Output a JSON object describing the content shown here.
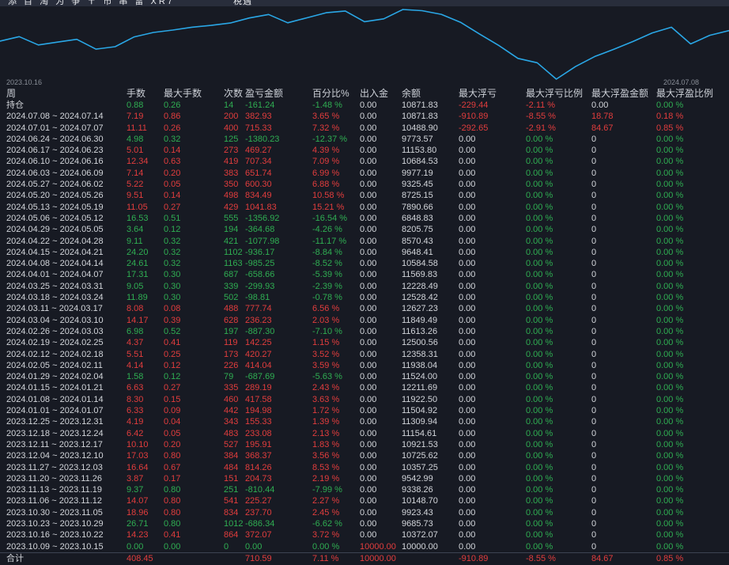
{
  "toolbar": {
    "left_text": "添 目 淘 为 争 〒 市 串 雷 XR7",
    "center_text": "税遇"
  },
  "chart": {
    "start_label": "2023.10.16",
    "end_label": "2024.07.08",
    "line_color": "#2aa7e6"
  },
  "chart_data": {
    "type": "line",
    "title": "",
    "xlabel": "",
    "ylabel": "",
    "legend": false,
    "grid": false,
    "x": [
      "2023.10.09",
      "2023.10.16",
      "2023.10.23",
      "2023.10.30",
      "2023.11.06",
      "2023.11.13",
      "2023.11.20",
      "2023.11.27",
      "2023.12.04",
      "2023.12.11",
      "2023.12.18",
      "2023.12.25",
      "2024.01.01",
      "2024.01.08",
      "2024.01.15",
      "2024.01.29",
      "2024.02.05",
      "2024.02.12",
      "2024.02.19",
      "2024.02.26",
      "2024.03.04",
      "2024.03.11",
      "2024.03.18",
      "2024.03.25",
      "2024.04.01",
      "2024.04.08",
      "2024.04.15",
      "2024.04.22",
      "2024.04.29",
      "2024.05.06",
      "2024.05.13",
      "2024.05.20",
      "2024.05.27",
      "2024.06.03",
      "2024.06.10",
      "2024.06.17",
      "2024.06.24",
      "2024.07.01",
      "2024.07.08"
    ],
    "values": [
      10000.0,
      10372.07,
      9685.73,
      9923.43,
      10148.7,
      9338.26,
      9542.99,
      10357.25,
      10725.62,
      10921.53,
      11154.61,
      11309.94,
      11504.92,
      11922.5,
      12211.69,
      11524.0,
      11938.04,
      12358.31,
      12500.56,
      11613.26,
      11849.49,
      12627.23,
      12528.42,
      12228.49,
      11569.83,
      10584.58,
      9648.41,
      8570.43,
      8205.75,
      6848.83,
      7890.66,
      8725.15,
      9325.45,
      9977.19,
      10684.53,
      11153.8,
      9773.57,
      10488.9,
      10871.83
    ],
    "ylim": [
      6848.83,
      12627.23
    ],
    "x_axis_start_label": "2023.10.16",
    "x_axis_end_label": "2024.07.08"
  },
  "colors": {
    "positive_red": "#e23d3d",
    "negative_green": "#2fae52",
    "chart_line": "#2aa7e6",
    "background": "#171a23"
  },
  "table": {
    "headers": [
      "周",
      "手数",
      "最大手数",
      "次数",
      "盈亏金额",
      "百分比%",
      "出入金",
      "余额",
      "最大浮亏",
      "最大浮亏比例",
      "最大浮盈金额",
      "最大浮盈比例"
    ],
    "rows": [
      [
        "持仓",
        "0.88",
        "0.26",
        "14",
        "-161.24",
        "-1.48 %",
        "0.00",
        "10871.83",
        "-229.44",
        "-2.11 %",
        "0.00",
        "0.00 %"
      ],
      [
        "2024.07.08 ~ 2024.07.14",
        "7.19",
        "0.86",
        "200",
        "382.93",
        "3.65 %",
        "0.00",
        "10871.83",
        "-910.89",
        "-8.55 %",
        "18.78",
        "0.18 %"
      ],
      [
        "2024.07.01 ~ 2024.07.07",
        "11.11",
        "0.26",
        "400",
        "715.33",
        "7.32 %",
        "0.00",
        "10488.90",
        "-292.65",
        "-2.91 %",
        "84.67",
        "0.85 %"
      ],
      [
        "2024.06.24 ~ 2024.06.30",
        "4.98",
        "0.32",
        "125",
        "-1380.23",
        "-12.37 %",
        "0.00",
        "9773.57",
        "0.00",
        "0.00 %",
        "0",
        "0.00 %"
      ],
      [
        "2024.06.17 ~ 2024.06.23",
        "5.01",
        "0.14",
        "273",
        "469.27",
        "4.39 %",
        "0.00",
        "11153.80",
        "0.00",
        "0.00 %",
        "0",
        "0.00 %"
      ],
      [
        "2024.06.10 ~ 2024.06.16",
        "12.34",
        "0.63",
        "419",
        "707.34",
        "7.09 %",
        "0.00",
        "10684.53",
        "0.00",
        "0.00 %",
        "0",
        "0.00 %"
      ],
      [
        "2024.06.03 ~ 2024.06.09",
        "7.14",
        "0.20",
        "383",
        "651.74",
        "6.99 %",
        "0.00",
        "9977.19",
        "0.00",
        "0.00 %",
        "0",
        "0.00 %"
      ],
      [
        "2024.05.27 ~ 2024.06.02",
        "5.22",
        "0.05",
        "350",
        "600.30",
        "6.88 %",
        "0.00",
        "9325.45",
        "0.00",
        "0.00 %",
        "0",
        "0.00 %"
      ],
      [
        "2024.05.20 ~ 2024.05.26",
        "9.51",
        "0.14",
        "498",
        "834.49",
        "10.58 %",
        "0.00",
        "8725.15",
        "0.00",
        "0.00 %",
        "0",
        "0.00 %"
      ],
      [
        "2024.05.13 ~ 2024.05.19",
        "11.05",
        "0.27",
        "429",
        "1041.83",
        "15.21 %",
        "0.00",
        "7890.66",
        "0.00",
        "0.00 %",
        "0",
        "0.00 %"
      ],
      [
        "2024.05.06 ~ 2024.05.12",
        "16.53",
        "0.51",
        "555",
        "-1356.92",
        "-16.54 %",
        "0.00",
        "6848.83",
        "0.00",
        "0.00 %",
        "0",
        "0.00 %"
      ],
      [
        "2024.04.29 ~ 2024.05.05",
        "3.64",
        "0.12",
        "194",
        "-364.68",
        "-4.26 %",
        "0.00",
        "8205.75",
        "0.00",
        "0.00 %",
        "0",
        "0.00 %"
      ],
      [
        "2024.04.22 ~ 2024.04.28",
        "9.11",
        "0.32",
        "421",
        "-1077.98",
        "-11.17 %",
        "0.00",
        "8570.43",
        "0.00",
        "0.00 %",
        "0",
        "0.00 %"
      ],
      [
        "2024.04.15 ~ 2024.04.21",
        "24.20",
        "0.32",
        "1102",
        "-936.17",
        "-8.84 %",
        "0.00",
        "9648.41",
        "0.00",
        "0.00 %",
        "0",
        "0.00 %"
      ],
      [
        "2024.04.08 ~ 2024.04.14",
        "24.61",
        "0.32",
        "1163",
        "-985.25",
        "-8.52 %",
        "0.00",
        "10584.58",
        "0.00",
        "0.00 %",
        "0",
        "0.00 %"
      ],
      [
        "2024.04.01 ~ 2024.04.07",
        "17.31",
        "0.30",
        "687",
        "-658.66",
        "-5.39 %",
        "0.00",
        "11569.83",
        "0.00",
        "0.00 %",
        "0",
        "0.00 %"
      ],
      [
        "2024.03.25 ~ 2024.03.31",
        "9.05",
        "0.30",
        "339",
        "-299.93",
        "-2.39 %",
        "0.00",
        "12228.49",
        "0.00",
        "0.00 %",
        "0",
        "0.00 %"
      ],
      [
        "2024.03.18 ~ 2024.03.24",
        "11.89",
        "0.30",
        "502",
        "-98.81",
        "-0.78 %",
        "0.00",
        "12528.42",
        "0.00",
        "0.00 %",
        "0",
        "0.00 %"
      ],
      [
        "2024.03.11 ~ 2024.03.17",
        "8.08",
        "0.08",
        "488",
        "777.74",
        "6.56 %",
        "0.00",
        "12627.23",
        "0.00",
        "0.00 %",
        "0",
        "0.00 %"
      ],
      [
        "2024.03.04 ~ 2024.03.10",
        "14.17",
        "0.39",
        "628",
        "236.23",
        "2.03 %",
        "0.00",
        "11849.49",
        "0.00",
        "0.00 %",
        "0",
        "0.00 %"
      ],
      [
        "2024.02.26 ~ 2024.03.03",
        "6.98",
        "0.52",
        "197",
        "-887.30",
        "-7.10 %",
        "0.00",
        "11613.26",
        "0.00",
        "0.00 %",
        "0",
        "0.00 %"
      ],
      [
        "2024.02.19 ~ 2024.02.25",
        "4.37",
        "0.41",
        "119",
        "142.25",
        "1.15 %",
        "0.00",
        "12500.56",
        "0.00",
        "0.00 %",
        "0",
        "0.00 %"
      ],
      [
        "2024.02.12 ~ 2024.02.18",
        "5.51",
        "0.25",
        "173",
        "420.27",
        "3.52 %",
        "0.00",
        "12358.31",
        "0.00",
        "0.00 %",
        "0",
        "0.00 %"
      ],
      [
        "2024.02.05 ~ 2024.02.11",
        "4.14",
        "0.12",
        "226",
        "414.04",
        "3.59 %",
        "0.00",
        "11938.04",
        "0.00",
        "0.00 %",
        "0",
        "0.00 %"
      ],
      [
        "2024.01.29 ~ 2024.02.04",
        "1.58",
        "0.12",
        "79",
        "-687.69",
        "-5.63 %",
        "0.00",
        "11524.00",
        "0.00",
        "0.00 %",
        "0",
        "0.00 %"
      ],
      [
        "2024.01.15 ~ 2024.01.21",
        "6.63",
        "0.27",
        "335",
        "289.19",
        "2.43 %",
        "0.00",
        "12211.69",
        "0.00",
        "0.00 %",
        "0",
        "0.00 %"
      ],
      [
        "2024.01.08 ~ 2024.01.14",
        "8.30",
        "0.15",
        "460",
        "417.58",
        "3.63 %",
        "0.00",
        "11922.50",
        "0.00",
        "0.00 %",
        "0",
        "0.00 %"
      ],
      [
        "2024.01.01 ~ 2024.01.07",
        "6.33",
        "0.09",
        "442",
        "194.98",
        "1.72 %",
        "0.00",
        "11504.92",
        "0.00",
        "0.00 %",
        "0",
        "0.00 %"
      ],
      [
        "2023.12.25 ~ 2023.12.31",
        "4.19",
        "0.04",
        "343",
        "155.33",
        "1.39 %",
        "0.00",
        "11309.94",
        "0.00",
        "0.00 %",
        "0",
        "0.00 %"
      ],
      [
        "2023.12.18 ~ 2023.12.24",
        "6.42",
        "0.05",
        "483",
        "233.08",
        "2.13 %",
        "0.00",
        "11154.61",
        "0.00",
        "0.00 %",
        "0",
        "0.00 %"
      ],
      [
        "2023.12.11 ~ 2023.12.17",
        "10.10",
        "0.20",
        "527",
        "195.91",
        "1.83 %",
        "0.00",
        "10921.53",
        "0.00",
        "0.00 %",
        "0",
        "0.00 %"
      ],
      [
        "2023.12.04 ~ 2023.12.10",
        "17.03",
        "0.80",
        "384",
        "368.37",
        "3.56 %",
        "0.00",
        "10725.62",
        "0.00",
        "0.00 %",
        "0",
        "0.00 %"
      ],
      [
        "2023.11.27 ~ 2023.12.03",
        "16.64",
        "0.67",
        "484",
        "814.26",
        "8.53 %",
        "0.00",
        "10357.25",
        "0.00",
        "0.00 %",
        "0",
        "0.00 %"
      ],
      [
        "2023.11.20 ~ 2023.11.26",
        "3.87",
        "0.17",
        "151",
        "204.73",
        "2.19 %",
        "0.00",
        "9542.99",
        "0.00",
        "0.00 %",
        "0",
        "0.00 %"
      ],
      [
        "2023.11.13 ~ 2023.11.19",
        "9.37",
        "0.80",
        "251",
        "-810.44",
        "-7.99 %",
        "0.00",
        "9338.26",
        "0.00",
        "0.00 %",
        "0",
        "0.00 %"
      ],
      [
        "2023.11.06 ~ 2023.11.12",
        "14.07",
        "0.80",
        "541",
        "225.27",
        "2.27 %",
        "0.00",
        "10148.70",
        "0.00",
        "0.00 %",
        "0",
        "0.00 %"
      ],
      [
        "2023.10.30 ~ 2023.11.05",
        "18.96",
        "0.80",
        "834",
        "237.70",
        "2.45 %",
        "0.00",
        "9923.43",
        "0.00",
        "0.00 %",
        "0",
        "0.00 %"
      ],
      [
        "2023.10.23 ~ 2023.10.29",
        "26.71",
        "0.80",
        "1012",
        "-686.34",
        "-6.62 %",
        "0.00",
        "9685.73",
        "0.00",
        "0.00 %",
        "0",
        "0.00 %"
      ],
      [
        "2023.10.16 ~ 2023.10.22",
        "14.23",
        "0.41",
        "864",
        "372.07",
        "3.72 %",
        "0.00",
        "10372.07",
        "0.00",
        "0.00 %",
        "0",
        "0.00 %"
      ],
      [
        "2023.10.09 ~ 2023.10.15",
        "0.00",
        "0.00",
        "0",
        "0.00",
        "0.00 %",
        "10000.00",
        "10000.00",
        "0.00",
        "0.00 %",
        "0",
        "0.00 %"
      ]
    ],
    "total": [
      "合计",
      "408.45",
      "",
      "",
      "710.59",
      "7.11 %",
      "10000.00",
      "",
      "-910.89",
      "-8.55 %",
      "84.67",
      "0.85 %"
    ]
  }
}
